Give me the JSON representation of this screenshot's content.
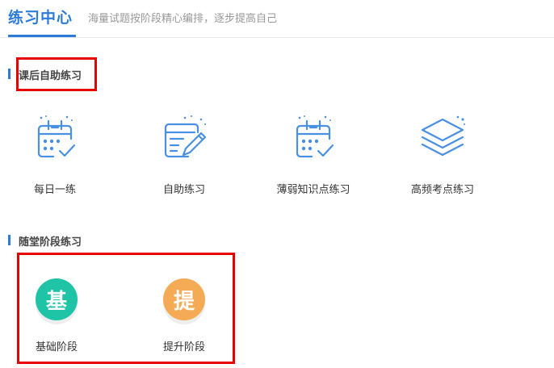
{
  "header": {
    "title": "练习中心",
    "subtitle": "海量试题按阶段精心编排，逐步提高自己"
  },
  "sections": {
    "after_class": {
      "title": "课后自助练习",
      "items": [
        {
          "label": "每日一练",
          "icon": "calendar-check-icon"
        },
        {
          "label": "自助练习",
          "icon": "edit-document-icon"
        },
        {
          "label": "薄弱知识点练习",
          "icon": "calendar-check-icon"
        },
        {
          "label": "高频考点练习",
          "icon": "layers-icon"
        }
      ]
    },
    "stage": {
      "title": "随堂阶段练习",
      "items": [
        {
          "label": "基础阶段",
          "badge": "基",
          "color": "#1fc4a6"
        },
        {
          "label": "提升阶段",
          "badge": "提",
          "color": "#f5aa55"
        }
      ]
    }
  },
  "colors": {
    "accent": "#2d7bd9",
    "highlight": "#e60000",
    "icon": "#4a90e2"
  }
}
